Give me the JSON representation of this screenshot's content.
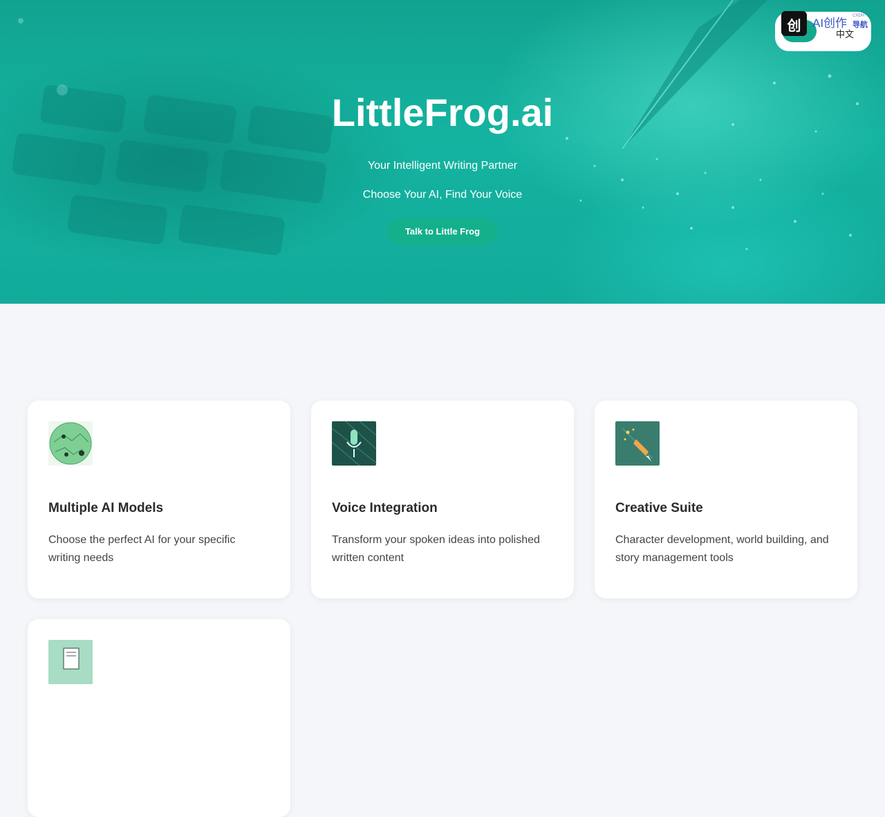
{
  "hero": {
    "title": "LittleFrog.ai",
    "subtitle_1": "Your Intelligent Writing Partner",
    "subtitle_2": "Choose Your AI, Find Your Voice",
    "cta_label": "Talk to Little Frog"
  },
  "lang_widget": {
    "label": "中文",
    "badge_char": "创",
    "brand_text": "AI创作",
    "brand_text_small": "导航",
    "brand_text_tiny": "CXDH"
  },
  "features": [
    {
      "icon": "frog-planet-icon",
      "title": "Multiple AI Models",
      "description": "Choose the perfect AI for your specific writing needs"
    },
    {
      "icon": "microphone-icon",
      "title": "Voice Integration",
      "description": "Transform your spoken ideas into polished written content"
    },
    {
      "icon": "quill-stars-icon",
      "title": "Creative Suite",
      "description": "Character development, world building, and story management tools"
    },
    {
      "icon": "document-icon",
      "title": "",
      "description": ""
    }
  ],
  "colors": {
    "accent": "#14b08c",
    "hero_bg": "#12ab9b",
    "page_bg": "#f4f6fa",
    "brand_blue": "#3a56c8"
  }
}
